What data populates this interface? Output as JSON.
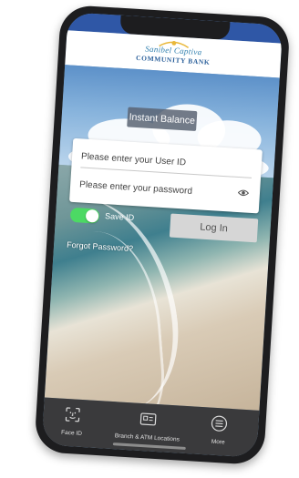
{
  "brand": {
    "logo_line1": "Sanibel Captiva",
    "logo_line2": "COMMUNITY BANK"
  },
  "hero": {
    "instant_balance_label": "Instant Balance"
  },
  "login": {
    "user_id_placeholder": "Please enter your User ID",
    "password_placeholder": "Please enter your password",
    "save_id_label": "Save ID",
    "save_id_enabled": true,
    "login_button_label": "Log In",
    "forgot_password_label": "Forgot Password?"
  },
  "bottom_nav": {
    "items": [
      {
        "label": "Face ID",
        "icon": "face-id-icon"
      },
      {
        "label": "Branch & ATM Locations",
        "icon": "map-card-icon"
      },
      {
        "label": "More",
        "icon": "menu-icon"
      }
    ]
  },
  "colors": {
    "status_strip": "#2f57a6",
    "toggle_on": "#4cd964",
    "logo_blue": "#2a5f9a"
  }
}
